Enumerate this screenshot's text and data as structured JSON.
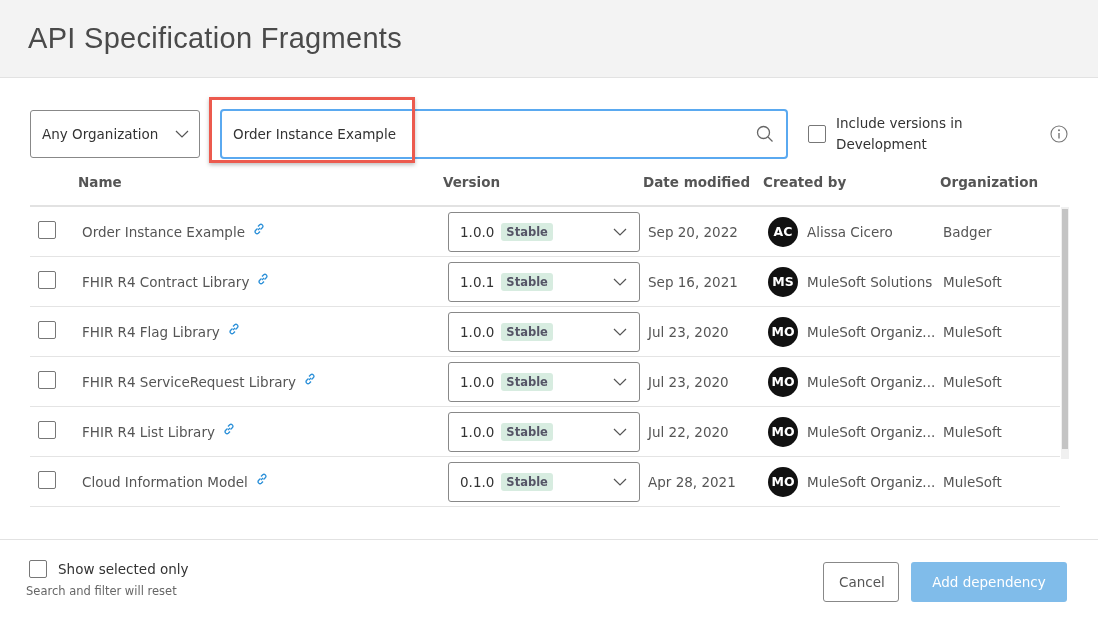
{
  "dialog": {
    "title": "API Specification Fragments"
  },
  "filters": {
    "organization": {
      "value": "Any Organization"
    },
    "search": {
      "value": "Order Instance Example",
      "highlighted": true
    },
    "include_development": {
      "label": "Include versions in Development",
      "checked": false
    }
  },
  "table": {
    "columns": [
      "Name",
      "Version",
      "Date modified",
      "Created by",
      "Organization"
    ],
    "rows": [
      {
        "selected": false,
        "name": "Order Instance Example",
        "version": "1.0.0",
        "status": "Stable",
        "date": "Sep 20, 2022",
        "avatar": "AC",
        "creator": "Alissa Cicero",
        "organization": "Badger"
      },
      {
        "selected": false,
        "name": "FHIR R4 Contract Library",
        "version": "1.0.1",
        "status": "Stable",
        "date": "Sep 16, 2021",
        "avatar": "MS",
        "creator": "MuleSoft Solutions",
        "organization": "MuleSoft"
      },
      {
        "selected": false,
        "name": "FHIR R4 Flag Library",
        "version": "1.0.0",
        "status": "Stable",
        "date": "Jul 23, 2020",
        "avatar": "MO",
        "creator": "MuleSoft Organiz...",
        "organization": "MuleSoft"
      },
      {
        "selected": false,
        "name": "FHIR R4 ServiceRequest Library",
        "version": "1.0.0",
        "status": "Stable",
        "date": "Jul 23, 2020",
        "avatar": "MO",
        "creator": "MuleSoft Organiz...",
        "organization": "MuleSoft"
      },
      {
        "selected": false,
        "name": "FHIR R4 List Library",
        "version": "1.0.0",
        "status": "Stable",
        "date": "Jul 22, 2020",
        "avatar": "MO",
        "creator": "MuleSoft Organiz...",
        "organization": "MuleSoft"
      },
      {
        "selected": false,
        "name": "Cloud Information Model",
        "version": "0.1.0",
        "status": "Stable",
        "date": "Apr 28, 2021",
        "avatar": "MO",
        "creator": "MuleSoft Organiz...",
        "organization": "MuleSoft"
      }
    ]
  },
  "footer": {
    "show_selected": {
      "label": "Show selected only",
      "checked": false
    },
    "hint": "Search and filter will reset",
    "buttons": [
      {
        "label": "Cancel",
        "kind": "secondary",
        "disabled": false
      },
      {
        "label": "Add dependency",
        "kind": "primary",
        "disabled": true
      }
    ]
  }
}
